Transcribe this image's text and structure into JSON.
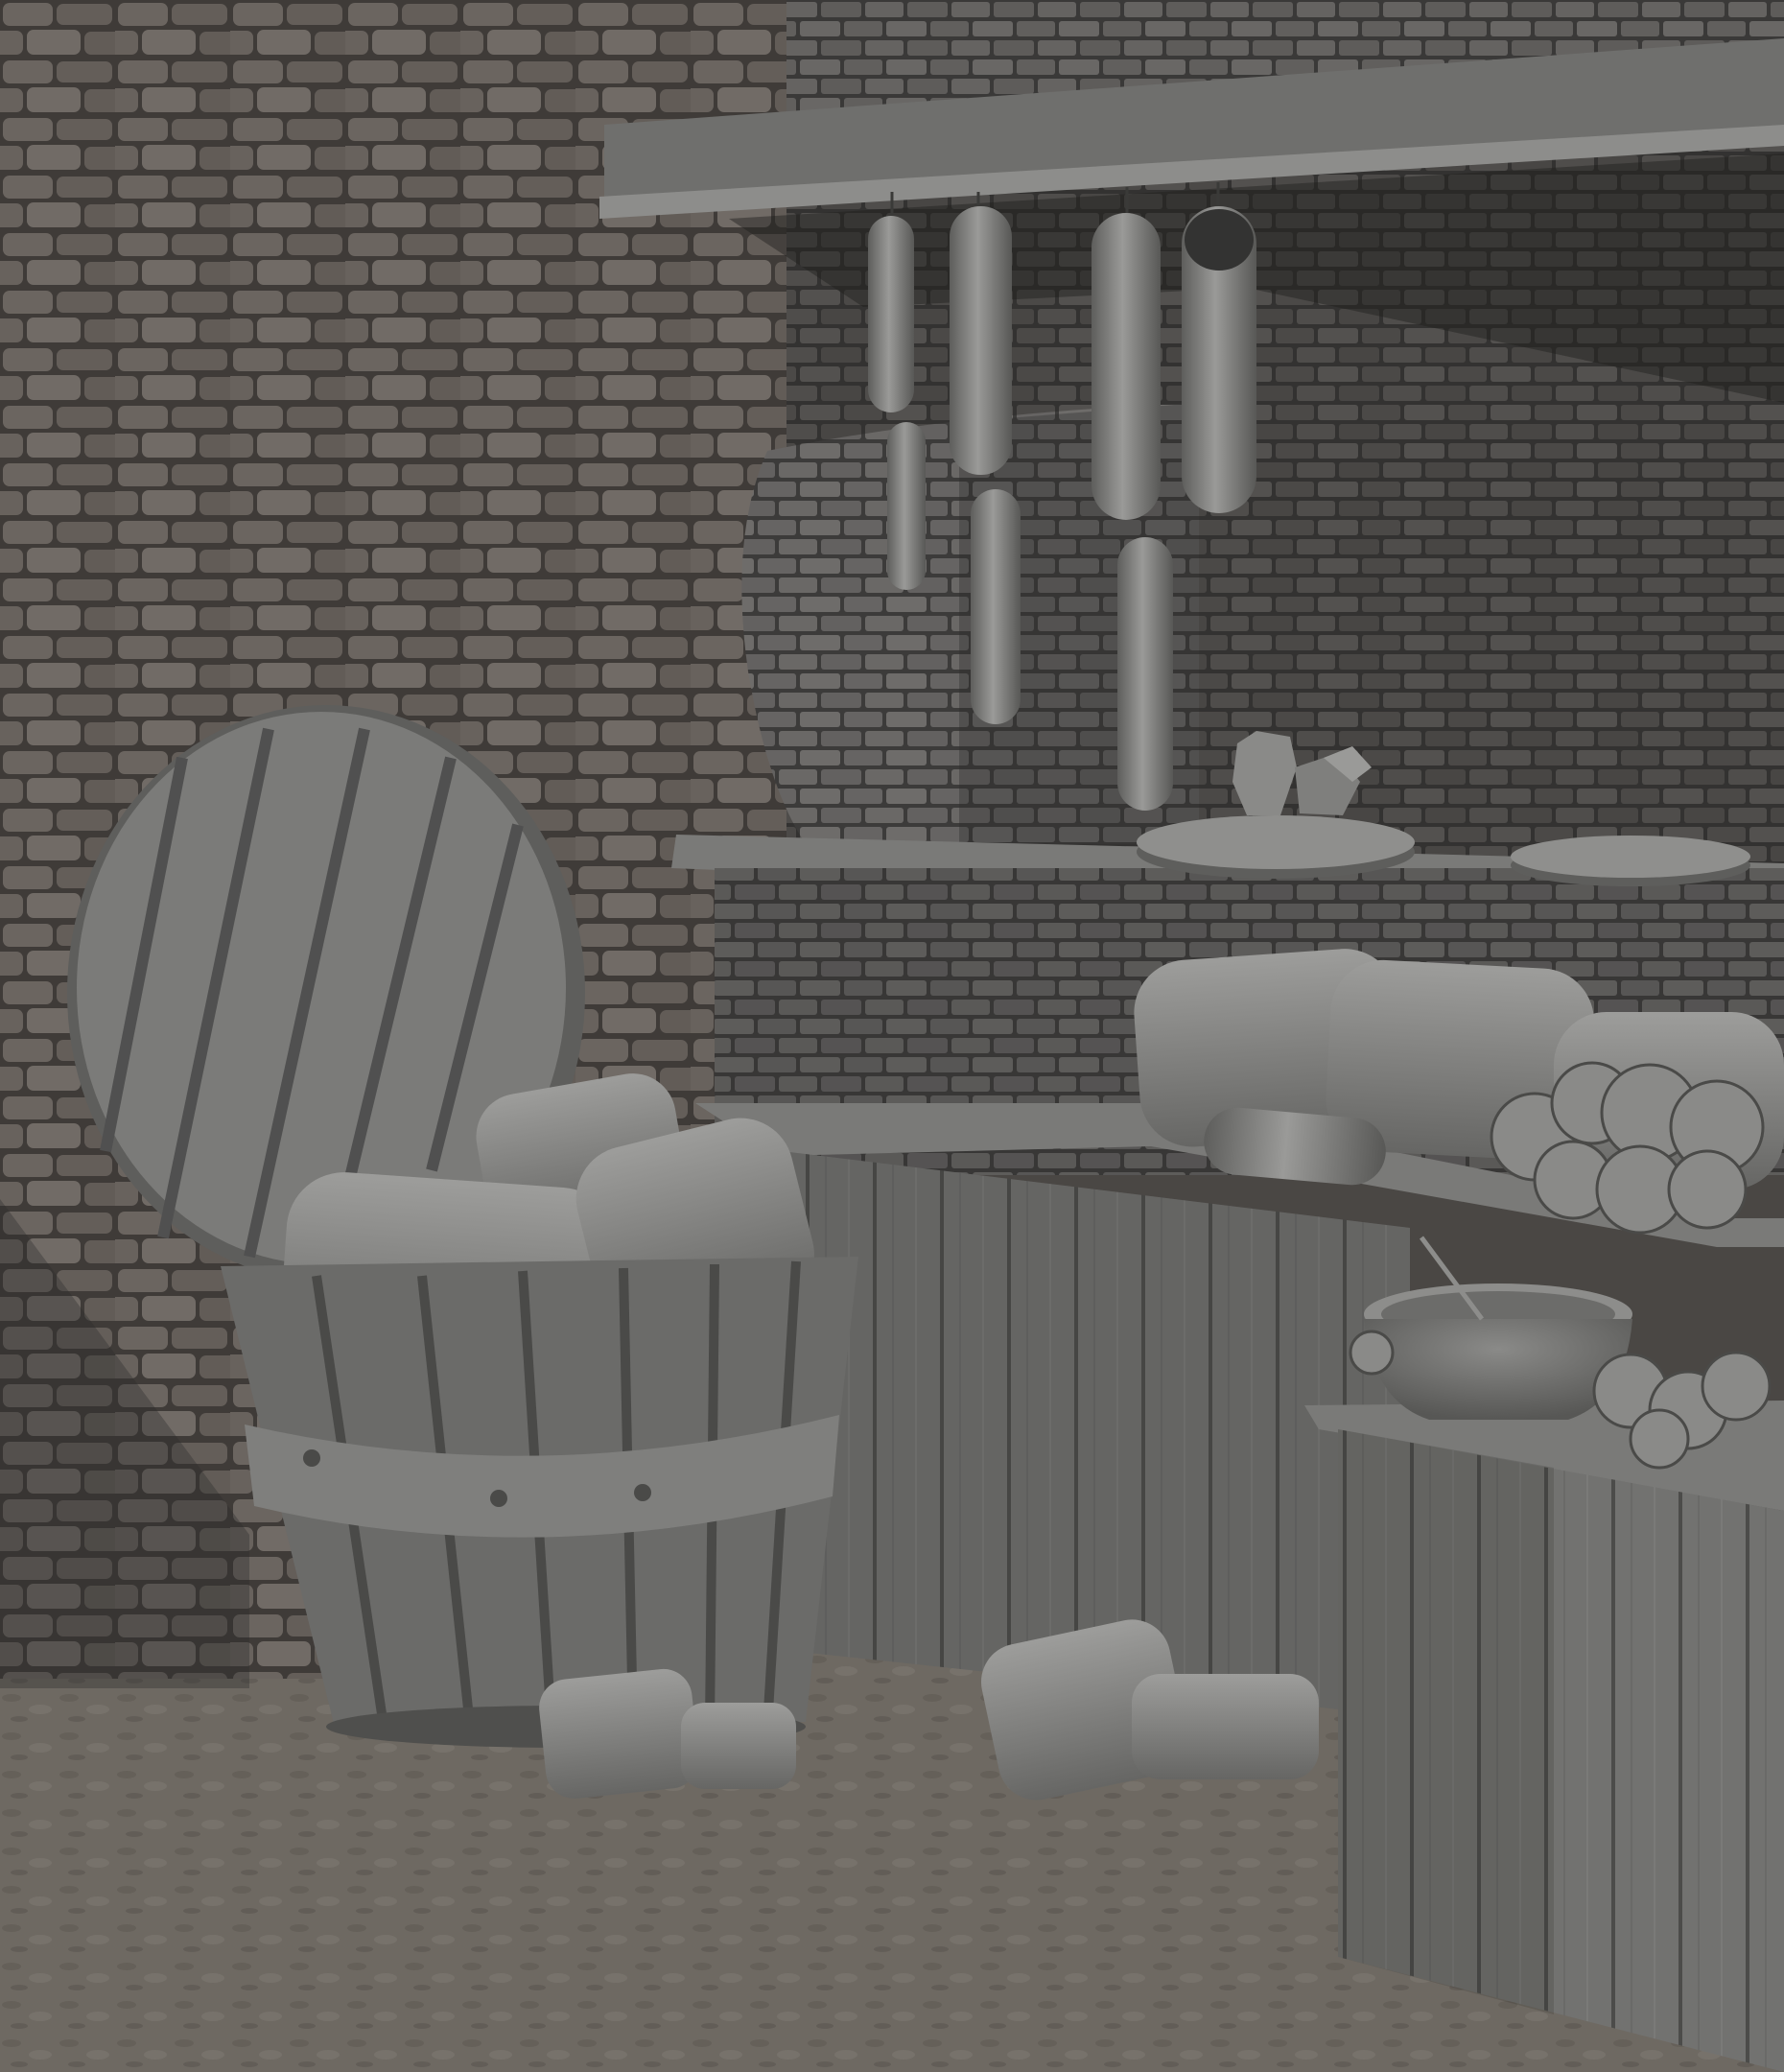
{
  "scene": {
    "palette": {
      "wall_stone": "#6b6560",
      "wall_stone_dark": "#4f4a46",
      "mortar": "#3f3b38",
      "brick_dark": "#4a4846",
      "brick_light": "#6a6866",
      "wood": "#727270",
      "wood_dark": "#555553",
      "ground": "#6e6962",
      "ground_dark": "#5d5852",
      "clay": "#7f7f7d",
      "shadow": "#2c2b2a",
      "leaf": "#8a8a88"
    },
    "objects": [
      "stone-wall",
      "brick-wall",
      "brick-oven",
      "wooden-shelf",
      "hanging-sausages",
      "brick-counter",
      "wooden-stall-counter",
      "cheese-wheels",
      "bread-loaves",
      "tub-lid",
      "wooden-tub",
      "sacks",
      "side-table",
      "bowl",
      "herb-bunches"
    ]
  }
}
